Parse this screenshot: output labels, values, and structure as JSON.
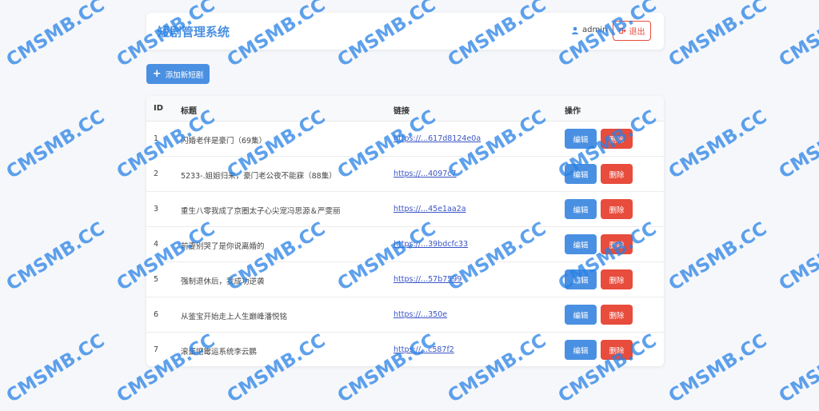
{
  "header": {
    "title": "短剧管理系统",
    "username": "admin",
    "logout_label": "退出"
  },
  "toolbar": {
    "add_label": "添加新短剧"
  },
  "table": {
    "columns": [
      "ID",
      "标题",
      "链接",
      "操作"
    ],
    "rows": [
      {
        "id": "1",
        "title": "闪婚老伴是豪门（69集）",
        "link": "https://...617d8124e0a",
        "edit": "编辑",
        "delete": "删除"
      },
      {
        "id": "2",
        "title": "5233-.姐姐归来，豪门老公夜不能寐（88集）",
        "link": "https://...4097c7",
        "edit": "编辑",
        "delete": "删除"
      },
      {
        "id": "3",
        "title": "重生八零我成了京圈太子心尖宠冯思源＆严雯丽",
        "link": "https://...45e1aa2a",
        "edit": "编辑",
        "delete": "删除"
      },
      {
        "id": "4",
        "title": "前妻别哭了是你说离婚的",
        "link": "https://...39bdcfc33",
        "edit": "编辑",
        "delete": "删除"
      },
      {
        "id": "5",
        "title": "强制退休后，我成功逆袭",
        "link": "https://...57b7599",
        "edit": "编辑",
        "delete": "删除"
      },
      {
        "id": "6",
        "title": "从鉴宝开始走上人生巅峰潘悦铭",
        "link": "https://...350e",
        "edit": "编辑",
        "delete": "删除"
      },
      {
        "id": "7",
        "title": "滚蛋吧霉运系统李云鹏",
        "link": "https://...c587f2",
        "edit": "编辑",
        "delete": "删除"
      }
    ]
  },
  "watermark": "CMSMB.CC",
  "colors": {
    "accent": "#4a90e2",
    "danger": "#e74c3c",
    "background": "#f5f7fa",
    "watermark": "#2882e6"
  }
}
